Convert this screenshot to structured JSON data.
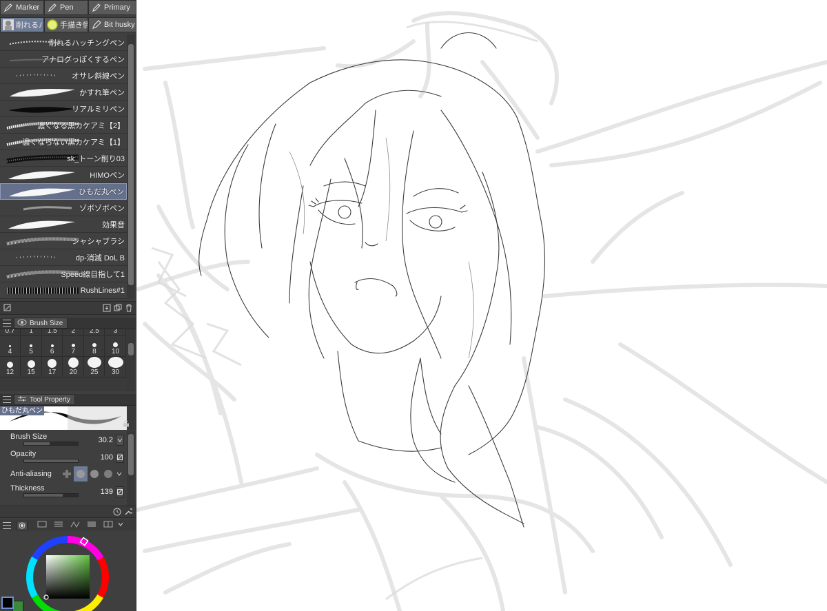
{
  "tool_tabs": [
    {
      "label": "Marker",
      "icon": "marker-icon"
    },
    {
      "label": "Pen",
      "icon": "pen-icon"
    },
    {
      "label": "Primary",
      "icon": "pencil-icon"
    }
  ],
  "subtool_tabs": [
    {
      "label": "削れるハ",
      "icon": "avatar-icon",
      "active": true
    },
    {
      "label": "手描き情",
      "icon": "circle-brush-icon"
    },
    {
      "label": "Bit husky",
      "icon": "pen-nib-icon"
    }
  ],
  "brushes": [
    {
      "name": "削れるハッチングペン",
      "icon": "hatching-stroke"
    },
    {
      "name": "アナログっぽくするペン",
      "icon": "faint-stroke"
    },
    {
      "name": "オサレ斜線ペン",
      "icon": "dots-stroke"
    },
    {
      "name": "かすれ筆ペン",
      "icon": "brush-stroke"
    },
    {
      "name": "リアルミリペン",
      "icon": "black-stroke"
    },
    {
      "name": "濃くなる黒カケアミ【2】",
      "icon": "crosshatch-stroke"
    },
    {
      "name": "濃くならない黒カケアミ【1】",
      "icon": "crosshatch-stroke"
    },
    {
      "name": "sk_トーン削り03",
      "icon": "tone-stroke"
    },
    {
      "name": "HIMOペン",
      "icon": "white-stroke"
    },
    {
      "name": "ひもだ丸ペン",
      "icon": "white-stroke",
      "selected": true
    },
    {
      "name": "ゾボゾボペン",
      "icon": "gray-stroke"
    },
    {
      "name": "効果音",
      "icon": "white-stroke"
    },
    {
      "name": "シャシャブラシ",
      "icon": "speckle-stroke"
    },
    {
      "name": "dp-消滅 DoL B",
      "icon": "dots-stroke"
    },
    {
      "name": "Speed線目指して1",
      "icon": "speckle-stroke"
    },
    {
      "name": "RushLines#1",
      "icon": "rush-stroke"
    }
  ],
  "brush_size_panel": {
    "tab_label": "Brush Size",
    "top_partial": [
      "0.7",
      "1",
      "1.5",
      "2",
      "2.5",
      "3"
    ],
    "sizes": [
      {
        "label": "4",
        "dot": 3
      },
      {
        "label": "5",
        "dot": 4
      },
      {
        "label": "6",
        "dot": 4
      },
      {
        "label": "7",
        "dot": 5
      },
      {
        "label": "8",
        "dot": 6
      },
      {
        "label": "10",
        "dot": 7
      },
      {
        "label": "12",
        "dot": 9
      },
      {
        "label": "15",
        "dot": 11
      },
      {
        "label": "17",
        "dot": 13
      },
      {
        "label": "20",
        "dot": 15
      },
      {
        "label": "25",
        "dot": 20
      },
      {
        "label": "30",
        "dot": 22
      }
    ]
  },
  "tool_property": {
    "tab_label": "Tool Property",
    "preview_name": "ひもだ丸ペン",
    "rows": [
      {
        "label": "Brush Size",
        "value": "30.2",
        "fill": 0.48
      },
      {
        "label": "Opacity",
        "value": "100",
        "fill": 1.0
      },
      {
        "label": "Anti-aliasing",
        "value": ""
      },
      {
        "label": "Thickness",
        "value": "139",
        "fill": 0.72
      }
    ]
  },
  "colors": {
    "panel_bg": "#3f3f3f",
    "tab_active": "#6e7c96",
    "selected_item": "#65718c",
    "main_color": "#000000",
    "sub_color": "#2e8b2e"
  }
}
